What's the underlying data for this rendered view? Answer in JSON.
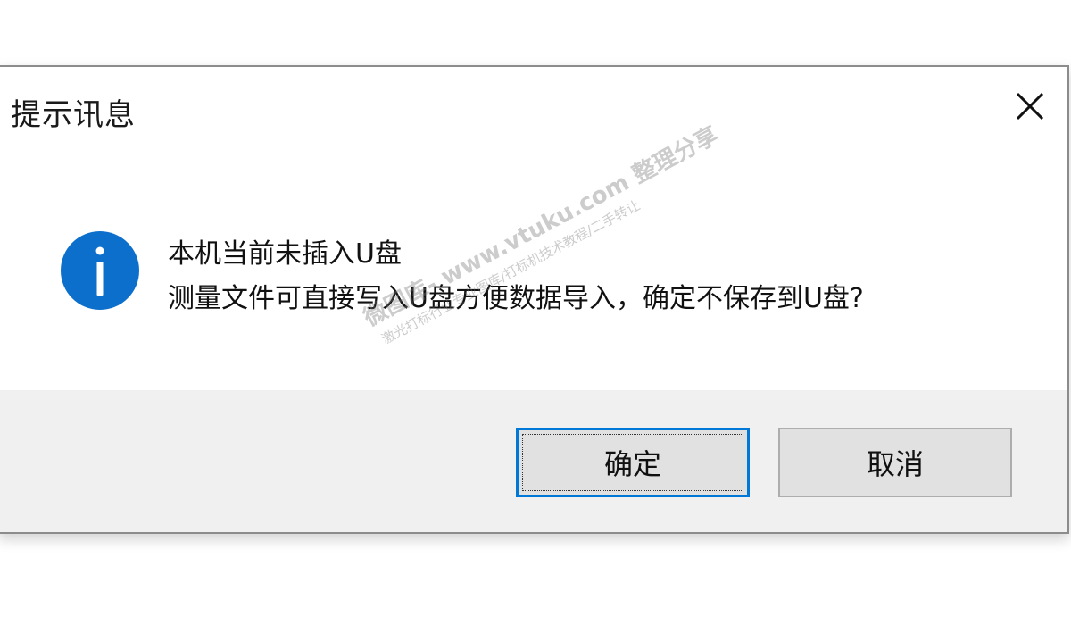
{
  "dialog": {
    "title": "提示讯息",
    "close_icon": "close-icon",
    "info_icon": "info-icon",
    "message_line1": "本机当前未插入U盘",
    "message_line2": "测量文件可直接写入U盘方便数据导入，确定不保存到U盘?",
    "ok_label": "确定",
    "cancel_label": "取消",
    "accent_color": "#0078d7"
  },
  "watermark": {
    "line1": "微图库- www.vtuku.com 整理分享",
    "line2": "激光打标行业专业图库/打标机技术教程/二手转让"
  }
}
